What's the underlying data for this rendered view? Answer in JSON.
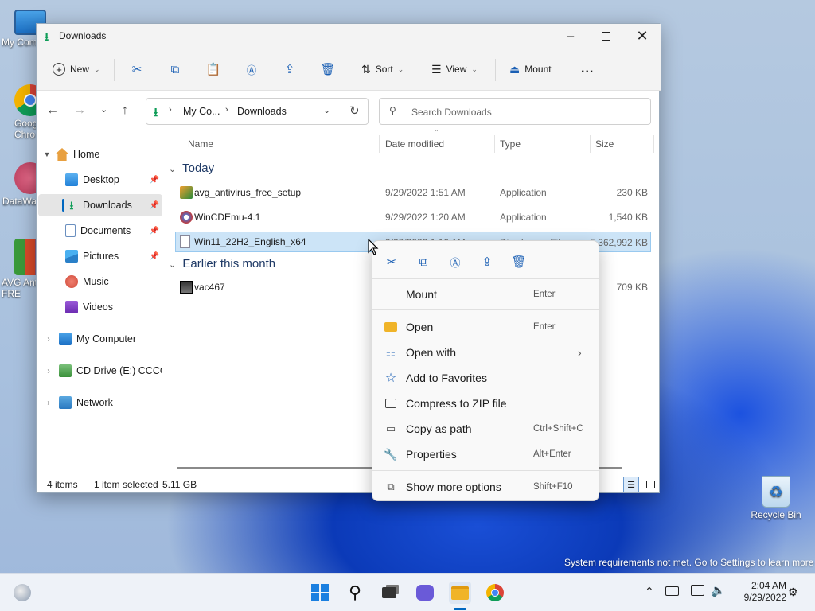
{
  "desktop": {
    "icons": [
      {
        "label": "My Com"
      },
      {
        "label": "Goog\nChro"
      },
      {
        "label": "DataWa"
      },
      {
        "label": "AVG Ant\nFRE"
      }
    ],
    "recycle_bin": "Recycle Bin",
    "watermark": "System requirements not met. Go to Settings to learn more"
  },
  "window": {
    "title": "Downloads",
    "toolbar": {
      "new_label": "New",
      "sort_label": "Sort",
      "view_label": "View",
      "mount_label": "Mount",
      "more_label": "..."
    },
    "address": {
      "crumb1": "My Co...",
      "crumb2": "Downloads"
    },
    "search_placeholder": "Search Downloads",
    "nav": {
      "home": "Home",
      "quick": [
        {
          "label": "Desktop",
          "pinned": true
        },
        {
          "label": "Downloads",
          "pinned": true
        },
        {
          "label": "Documents",
          "pinned": true
        },
        {
          "label": "Pictures",
          "pinned": true
        },
        {
          "label": "Music",
          "pinned": false
        },
        {
          "label": "Videos",
          "pinned": false
        }
      ],
      "my_computer": "My Computer",
      "cd_drive": "CD Drive (E:) CCCOI",
      "network": "Network"
    },
    "columns": {
      "name": "Name",
      "date": "Date modified",
      "type": "Type",
      "size": "Size"
    },
    "groups": {
      "today": "Today",
      "earlier": "Earlier this month"
    },
    "files": [
      {
        "name": "avg_antivirus_free_setup",
        "date": "9/29/2022 1:51 AM",
        "type": "Application",
        "size": "230 KB"
      },
      {
        "name": "WinCDEmu-4.1",
        "date": "9/29/2022 1:20 AM",
        "type": "Application",
        "size": "1,540 KB"
      },
      {
        "name": "Win11_22H2_English_x64",
        "date": "9/29/2022 1:10 AM",
        "type": "Disc Image File",
        "size": "5,362,992 KB",
        "selected": true
      },
      {
        "name": "vac467",
        "date": "",
        "type": "",
        "size": "709 KB"
      }
    ],
    "status": {
      "items": "4 items",
      "selected": "1 item selected",
      "size": "5.11 GB"
    }
  },
  "context_menu": {
    "mount": {
      "label": "Mount",
      "shortcut": "Enter"
    },
    "open": {
      "label": "Open",
      "shortcut": "Enter"
    },
    "open_with": {
      "label": "Open with"
    },
    "favorites": {
      "label": "Add to Favorites"
    },
    "compress": {
      "label": "Compress to ZIP file"
    },
    "copy_path": {
      "label": "Copy as path",
      "shortcut": "Ctrl+Shift+C"
    },
    "properties": {
      "label": "Properties",
      "shortcut": "Alt+Enter"
    },
    "more": {
      "label": "Show more options",
      "shortcut": "Shift+F10"
    }
  },
  "taskbar": {
    "time": "2:04 AM",
    "date": "9/29/2022"
  },
  "colors": {
    "accent": "#0067c0",
    "selection": "#cce4f7",
    "nav_selected": "#e5e5e5"
  }
}
